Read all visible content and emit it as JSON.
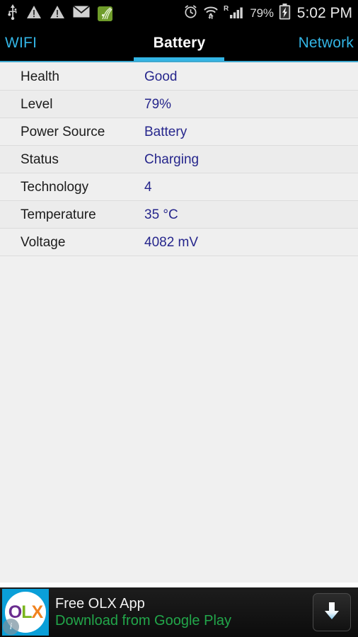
{
  "statusbar": {
    "left_icons": [
      {
        "name": "usb-icon",
        "label": "USB"
      },
      {
        "name": "warning-triangle-icon",
        "label": "Warning"
      },
      {
        "name": "warning-triangle-icon-2",
        "label": "Warning"
      },
      {
        "name": "email-envelope-icon",
        "label": "Email"
      },
      {
        "name": "app-notification-icon",
        "label": "App"
      }
    ],
    "right_icons": [
      {
        "name": "alarm-clock-icon",
        "label": "Alarm"
      },
      {
        "name": "wifi-icon",
        "label": "WiFi"
      },
      {
        "name": "roaming-signal-icon",
        "label": "R"
      }
    ],
    "battery_percent": "79%",
    "battery_state_icon": "battery-charging-icon",
    "time": "5:02 PM",
    "background": "#000000"
  },
  "tabs": {
    "items": [
      {
        "label": "WIFI",
        "active": false
      },
      {
        "label": "Battery",
        "active": true
      },
      {
        "label": "Network",
        "active": false
      }
    ],
    "active_color": "#ffffff",
    "inactive_color": "#33b5e5",
    "indicator_color": "#33b5e5"
  },
  "list": {
    "rows": [
      {
        "label": "Health",
        "value": "Good"
      },
      {
        "label": "Level",
        "value": "79%"
      },
      {
        "label": "Power Source",
        "value": "Battery"
      },
      {
        "label": "Status",
        "value": "Charging"
      },
      {
        "label": "Technology",
        "value": "4"
      },
      {
        "label": "Temperature",
        "value": "35 °C"
      },
      {
        "label": "Voltage",
        "value": "4082 mV"
      }
    ],
    "label_color": "#1b1b1b",
    "value_color": "#26268c",
    "row_background": "#efefef"
  },
  "ad": {
    "logo_text_o": "O",
    "logo_text_l": "L",
    "logo_text_x": "X",
    "info_badge": "i",
    "title": "Free OLX App",
    "subtitle": "Download from Google Play",
    "title_color": "#f2f2f2",
    "subtitle_color": "#22a64a",
    "button_icon": "download-arrow-icon",
    "background": "#141414"
  }
}
